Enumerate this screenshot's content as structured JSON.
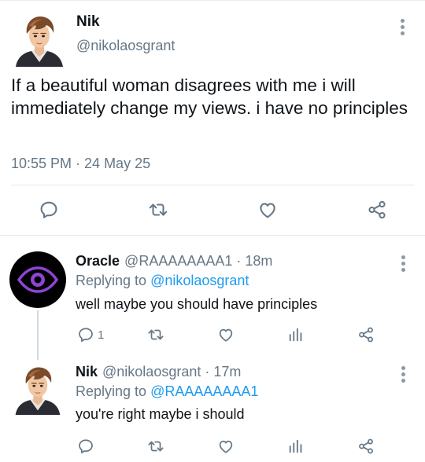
{
  "main_tweet": {
    "name": "Nik",
    "handle": "@nikolaosgrant",
    "text": "If a beautiful woman disagrees with me i will immediately change my views. i have no principles",
    "timestamp": "10:55 PM · 24 May 25",
    "actions": [
      "reply-icon",
      "retweet-icon",
      "like-icon",
      "share-icon"
    ]
  },
  "replies": [
    {
      "name": "Oracle",
      "meta": "@RAAAAAAAA1 · 18m",
      "replying_label": "Replying to",
      "replying_to": "@nikolaosgrant",
      "text": "well maybe you should have principles",
      "reply_count": "1",
      "actions": [
        "reply-icon",
        "retweet-icon",
        "like-icon",
        "analytics-icon",
        "share-icon"
      ]
    },
    {
      "name": "Nik",
      "meta": "@nikolaosgrant · 17m",
      "replying_label": "Replying to",
      "replying_to": "@RAAAAAAAA1",
      "text": "you're right maybe i should",
      "actions": [
        "reply-icon",
        "retweet-icon",
        "like-icon",
        "analytics-icon",
        "share-icon"
      ]
    }
  ],
  "colors": {
    "text": "#0f1419",
    "secondary": "#657786",
    "link": "#1d9bf0",
    "divider": "#e1e8ed",
    "oracle_eye": "#8e44d6"
  }
}
